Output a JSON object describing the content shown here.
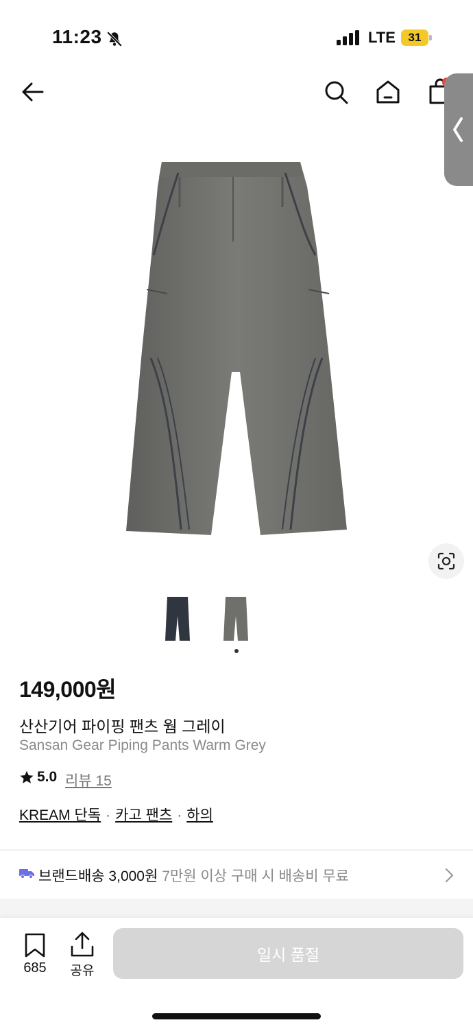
{
  "status_bar": {
    "time": "11:23",
    "network": "LTE",
    "battery": "31"
  },
  "header": {
    "back_icon": "back-arrow-icon",
    "search_icon": "search-icon",
    "home_icon": "home-icon",
    "cart_icon": "shopping-bag-icon"
  },
  "product": {
    "price": "149,000원",
    "name_ko": "산산기어 파이핑 팬츠 웜 그레이",
    "name_en": "Sansan Gear Piping Pants Warm Grey",
    "rating": "5.0",
    "review_label": "리뷰 15",
    "tags": [
      "KREAM 단독",
      "카고 팬츠",
      "하의"
    ],
    "tag_separator": "·",
    "thumbnails": [
      {
        "color": "#2f3640"
      },
      {
        "color": "#6f6f6b"
      }
    ]
  },
  "delivery": {
    "label": "브랜드배송 3,000원",
    "sub": "7만원 이상 구매 시 배송비 무료"
  },
  "bottom_bar": {
    "bookmark_count": "685",
    "share_label": "공유",
    "buy_label": "일시 품절"
  },
  "colors": {
    "accent": "#6b6fe8",
    "soldout_bg": "#d6d6d6",
    "battery": "#f3c928"
  }
}
